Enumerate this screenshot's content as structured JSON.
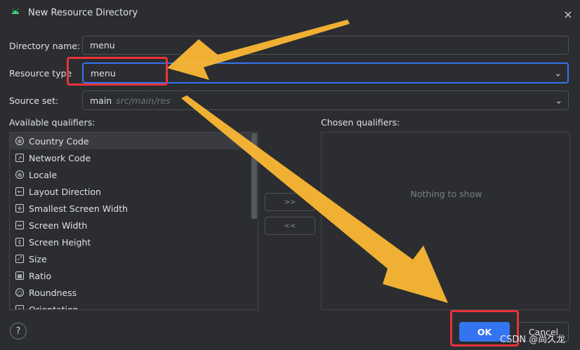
{
  "window": {
    "title": "New Resource Directory",
    "close_icon": "×"
  },
  "form": {
    "directory_name_label": "Directory name:",
    "directory_name_value": "menu",
    "resource_type_label": "Resource type",
    "resource_type_value": "menu",
    "source_set_label": "Source set:",
    "source_set_value": "main",
    "source_set_path": "src/main/res"
  },
  "available": {
    "label": "Available qualifiers:",
    "items": [
      {
        "label": "Country Code",
        "icon": "globe-cell-icon"
      },
      {
        "label": "Network Code",
        "icon": "network-icon"
      },
      {
        "label": "Locale",
        "icon": "globe-icon"
      },
      {
        "label": "Layout Direction",
        "icon": "direction-icon"
      },
      {
        "label": "Smallest Screen Width",
        "icon": "expand-icon"
      },
      {
        "label": "Screen Width",
        "icon": "width-icon"
      },
      {
        "label": "Screen Height",
        "icon": "height-icon"
      },
      {
        "label": "Size",
        "icon": "size-icon"
      },
      {
        "label": "Ratio",
        "icon": "ratio-icon"
      },
      {
        "label": "Roundness",
        "icon": "round-icon"
      },
      {
        "label": "Orientation",
        "icon": "orientation-icon"
      }
    ]
  },
  "transfer": {
    "add_label": ">>",
    "remove_label": "<<"
  },
  "chosen": {
    "label": "Chosen qualifiers:",
    "empty_text": "Nothing to show"
  },
  "footer": {
    "help_label": "?",
    "ok_label": "OK",
    "cancel_label": "Cancel"
  },
  "watermark": "CSDN @尚久龙",
  "colors": {
    "accent": "#3574f0",
    "annotation_red": "#e8343a",
    "annotation_arrow": "#fbb735"
  }
}
